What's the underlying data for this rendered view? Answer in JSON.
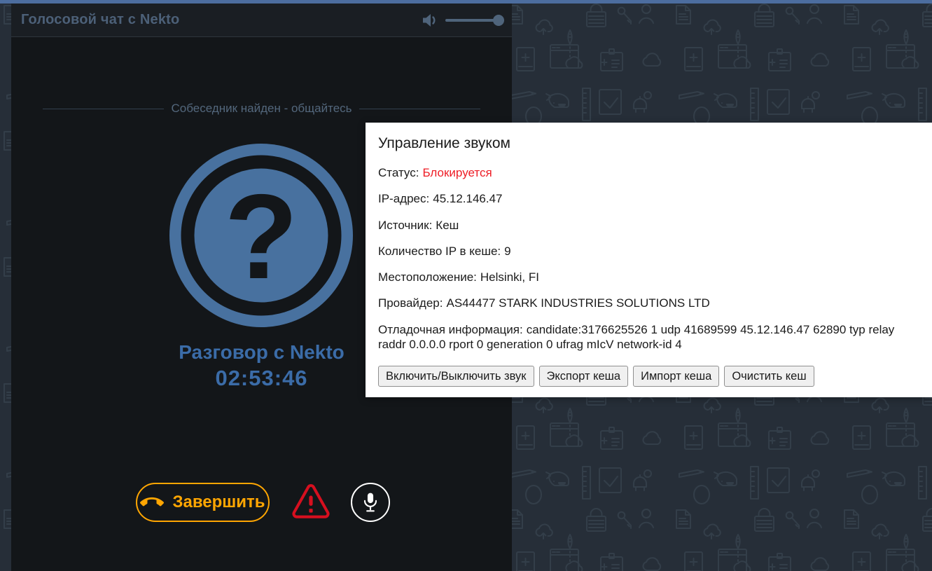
{
  "header": {
    "title": "Голосовой чат с Nekto",
    "volume": {
      "icon": "speaker-icon",
      "level_percent": 100
    }
  },
  "chat": {
    "status_banner": "Собеседник найден - общайтесь",
    "avatar_glyph": "?",
    "conversation_label": "Разговор с Nekto",
    "timer": "02:53:46",
    "controls": {
      "end_call_label": "Завершить",
      "end_call_icon": "phone-hangup-icon",
      "warning_icon": "warning-triangle-icon",
      "mic_icon": "microphone-icon"
    }
  },
  "sound_panel": {
    "title": "Управление звуком",
    "rows": [
      {
        "label": "Статус:",
        "value": "Блокируется",
        "highlight": "red"
      },
      {
        "label": "IP-адрес:",
        "value": "45.12.146.47"
      },
      {
        "label": "Источник:",
        "value": "Кеш"
      },
      {
        "label": "Количество IP в кеше:",
        "value": "9"
      },
      {
        "label": "Местоположение:",
        "value": "Helsinki, FI"
      },
      {
        "label": "Провайдер:",
        "value": "AS44477 STARK INDUSTRIES SOLUTIONS LTD"
      },
      {
        "label": "Отладочная информация:",
        "value": "candidate:3176625526 1 udp 41689599 45.12.146.47 62890 typ relay raddr 0.0.0.0 rport 0 generation 0 ufrag mIcV network-id 4"
      }
    ],
    "buttons": [
      "Включить/Выключить звук",
      "Экспорт кеша",
      "Импорт кеша",
      "Очистить кеш"
    ]
  },
  "background": {
    "doodle_icons": [
      "document-icon",
      "cloud-upload-icon",
      "rocket-icon",
      "lock-icon",
      "key-icon",
      "person-icon",
      "book-plus-icon",
      "browser-cloud-icon",
      "id-badge-icon",
      "cloud-icon",
      "pen-icon",
      "whale-icon",
      "ruler-icon",
      "checkbox-icon",
      "alarm-bell-icon",
      "egg-icon"
    ]
  },
  "colors": {
    "accent_blue": "#3b6ca8",
    "avatar_blue": "#48719f",
    "accent_orange": "#ffa602",
    "error_red": "#ee1c25",
    "top_strip_blue": "#4c6d9f"
  }
}
